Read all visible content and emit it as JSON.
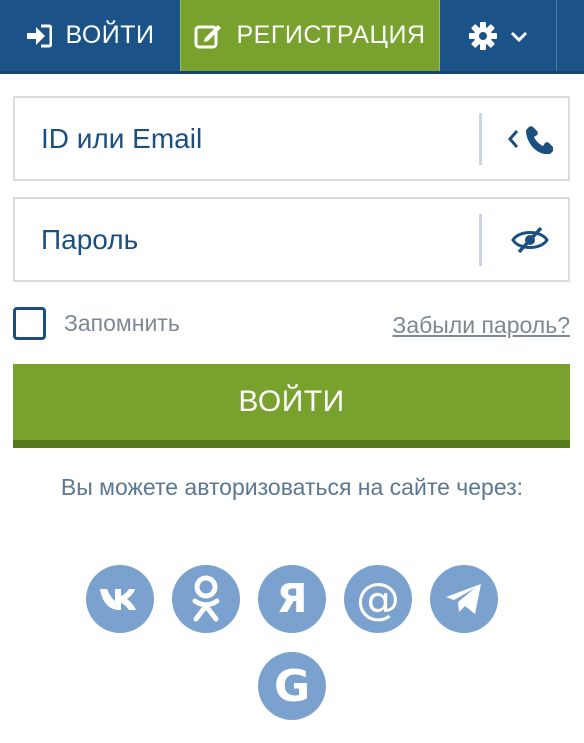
{
  "tabs": {
    "login": "ВОЙТИ",
    "register": "РЕГИСТРАЦИЯ"
  },
  "form": {
    "id_placeholder": "ID или Email",
    "password_placeholder": "Пароль",
    "remember_label": "Запомнить",
    "forgot_link": "Забыли пароль?",
    "submit_label": "ВОЙТИ"
  },
  "social": {
    "text": "Вы можете авторизоваться на сайте через:",
    "yandex_letter": "Я",
    "mailru_letter": "@",
    "google_letter": "G",
    "providers": [
      "vk-icon",
      "odnoklassniki-icon",
      "yandex-icon",
      "mailru-icon",
      "telegram-icon",
      "google-icon"
    ]
  },
  "colors": {
    "primary_blue": "#1b5389",
    "accent_green": "#78a22d",
    "social_circle": "#7ba2cf"
  }
}
